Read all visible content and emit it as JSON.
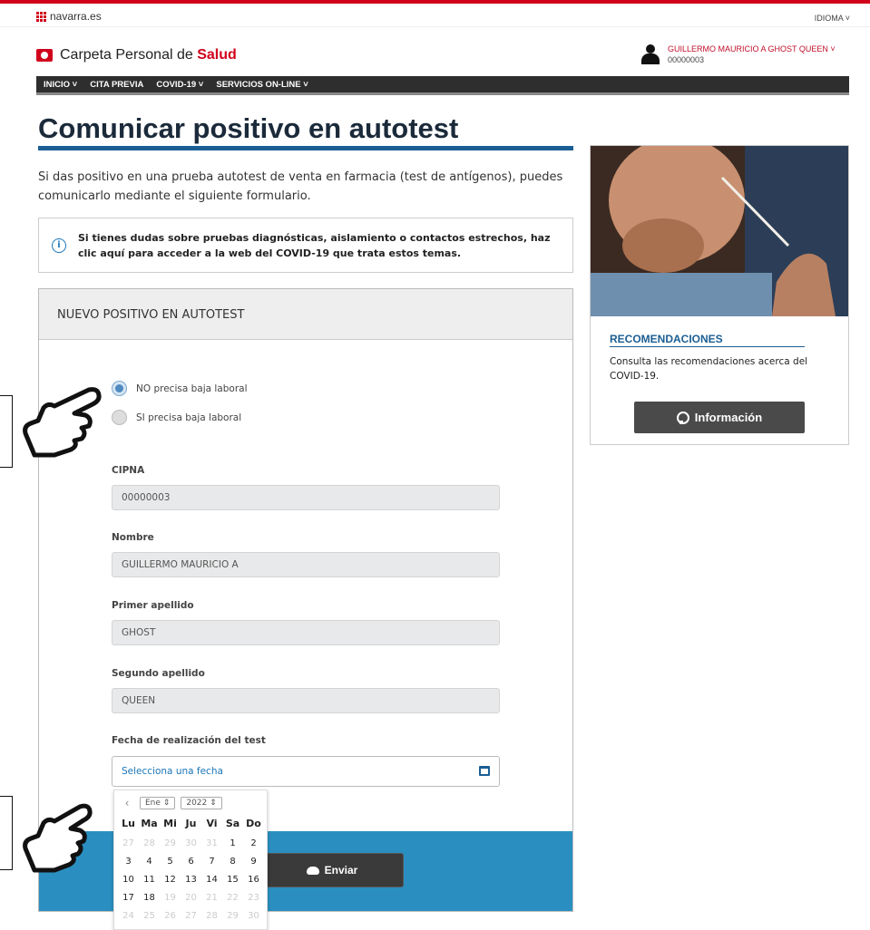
{
  "site": {
    "portal": "navarra.es",
    "language_menu": "IDIOMA ˅",
    "brand_prefix": "Carpeta Personal de",
    "brand_highlight": "Salud"
  },
  "user": {
    "name": "GUILLERMO MAURICIO A GHOST QUEEN ˅",
    "id": "00000003"
  },
  "nav": {
    "items": [
      "INICIO ˅",
      "CITA PREVIA",
      "COVID-19 ˅",
      "SERVICIOS ON-LINE ˅"
    ]
  },
  "page": {
    "title": "Comunicar positivo en autotest",
    "intro": "Si das positivo en una prueba autotest de venta en farmacia (test de antígenos), puedes comunicarlo mediante el siguiente formulario.",
    "info_text": "Si tienes dudas sobre pruebas diagnósticas, aislamiento o contactos estrechos, haz clic aquí para acceder a la web del COVID-19 que trata estos temas."
  },
  "form": {
    "header": "NUEVO POSITIVO EN AUTOTEST",
    "radio_options": [
      "NO precisa baja laboral",
      "SI precisa baja laboral"
    ],
    "selected_option": "NO precisa baja laboral",
    "fields": [
      {
        "label": "CIPNA",
        "value": "00000003"
      },
      {
        "label": "Nombre",
        "value": "GUILLERMO MAURICIO A"
      },
      {
        "label": "Primer apellido",
        "value": "GHOST"
      },
      {
        "label": "Segundo apellido",
        "value": "QUEEN"
      }
    ],
    "date_label": "Fecha de realización del test",
    "date_placeholder": "Selecciona una fecha",
    "submit_label": "Enviar"
  },
  "datepicker": {
    "month": "Ene",
    "year": "2022",
    "weekdays": [
      "Lu",
      "Ma",
      "Mi",
      "Ju",
      "Vi",
      "Sa",
      "Do"
    ],
    "rows": [
      [
        "27",
        "28",
        "29",
        "30",
        "31",
        "1",
        "2"
      ],
      [
        "3",
        "4",
        "5",
        "6",
        "7",
        "8",
        "9"
      ],
      [
        "10",
        "11",
        "12",
        "13",
        "14",
        "15",
        "16"
      ],
      [
        "17",
        "18",
        "19",
        "20",
        "21",
        "22",
        "23"
      ],
      [
        "24",
        "25",
        "26",
        "27",
        "28",
        "29",
        "30"
      ]
    ],
    "muted": [
      [
        true,
        true,
        true,
        true,
        true,
        false,
        false
      ],
      [
        false,
        false,
        false,
        false,
        false,
        false,
        false
      ],
      [
        false,
        false,
        false,
        false,
        false,
        false,
        false
      ],
      [
        false,
        false,
        true,
        true,
        true,
        true,
        true
      ],
      [
        true,
        true,
        true,
        true,
        true,
        true,
        true
      ]
    ]
  },
  "sidebar": {
    "title": "RECOMENDACIONES",
    "text": "Consulta las recomendaciones acerca del COVID-19.",
    "button_label": "Información"
  },
  "colors": {
    "brand_red": "#d0021b",
    "accent_blue": "#1b5e93",
    "footer_blue": "#2a8fc0"
  }
}
